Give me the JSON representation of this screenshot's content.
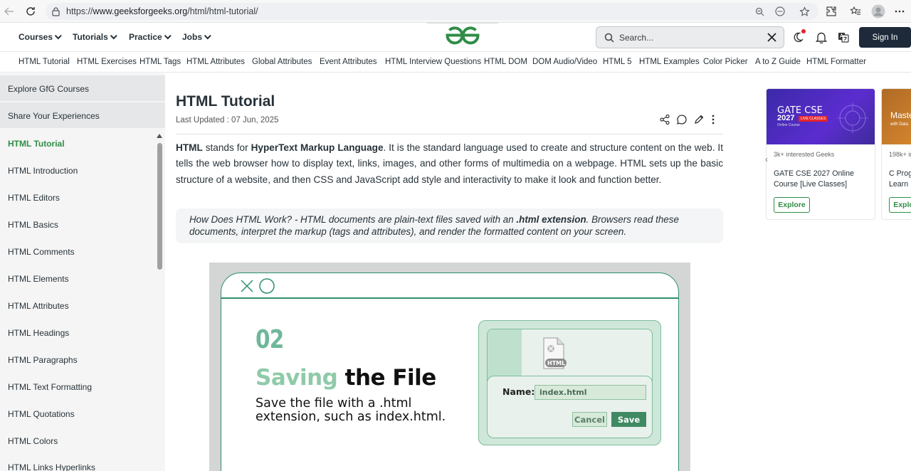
{
  "browser": {
    "url_prefix": "https://",
    "url_domain": "www.geeksforgeeks.org",
    "url_path": "/html/html-tutorial/"
  },
  "header": {
    "menus": [
      "Courses",
      "Tutorials",
      "Practice",
      "Jobs"
    ],
    "search_placeholder": "Search...",
    "signin_label": "Sign In",
    "brand_color": "#2f8d46"
  },
  "topics": [
    "HTML Tutorial",
    "HTML Exercises",
    "HTML Tags",
    "HTML Attributes",
    "Global Attributes",
    "Event Attributes",
    "HTML Interview Questions",
    "HTML DOM",
    "DOM Audio/Video",
    "HTML 5",
    "HTML Examples",
    "Color Picker",
    "A to Z Guide",
    "HTML Formatter"
  ],
  "sidebar": {
    "explore": "Explore GfG Courses",
    "share": "Share Your Experiences",
    "items": [
      "HTML Tutorial",
      "HTML Introduction",
      "HTML Editors",
      "HTML Basics",
      "HTML Comments",
      "HTML Elements",
      "HTML Attributes",
      "HTML Headings",
      "HTML Paragraphs",
      "HTML Text Formatting",
      "HTML Quotations",
      "HTML Colors",
      "HTML Links Hyperlinks"
    ],
    "active_index": 0
  },
  "article": {
    "title": "HTML Tutorial",
    "updated": "Last Updated : 07 Jun, 2025",
    "intro": {
      "b1": "HTML",
      "t1": " stands for ",
      "b2": "HyperText Markup Language",
      "t2": ". It is the standard language used to create and structure content on the web. It tells the web browser how to display text, links, images, and other forms of multimedia on a webpage. HTML sets up the basic structure of a website, and then CSS and JavaScript add style and interactivity to make it look and function better."
    },
    "note": {
      "t1": "How Does HTML Work? - HTML documents are plain-text files saved with an ",
      "b1": ".html extension",
      "t2": ". Browsers read these documents, interpret the markup (tags and attributes), and render the formatted content on your screen."
    }
  },
  "illustration": {
    "step": "02",
    "title_a": "Saving",
    "title_b": " the File",
    "desc": "Save the file with a .html extension, such as index.html.",
    "name_label": "Name:",
    "file_name": "index.html",
    "cancel": "Cancel",
    "save": "Save",
    "file_badge": "HTML"
  },
  "ads": [
    {
      "banner_line1": "GATE CSE",
      "banner_line2": "2027",
      "banner_tag": "LIVE CLASSES",
      "banner_sub": "Online Course",
      "geeks": "3k+ interested Geeks",
      "title": "GATE CSE 2027 Online Course [Live Classes]",
      "button": "Explore"
    },
    {
      "banner_line1": "Maste",
      "banner_sub": "with Data",
      "geeks": "198k+ in",
      "title": "C Progr - Learn",
      "button": "Explo"
    }
  ]
}
